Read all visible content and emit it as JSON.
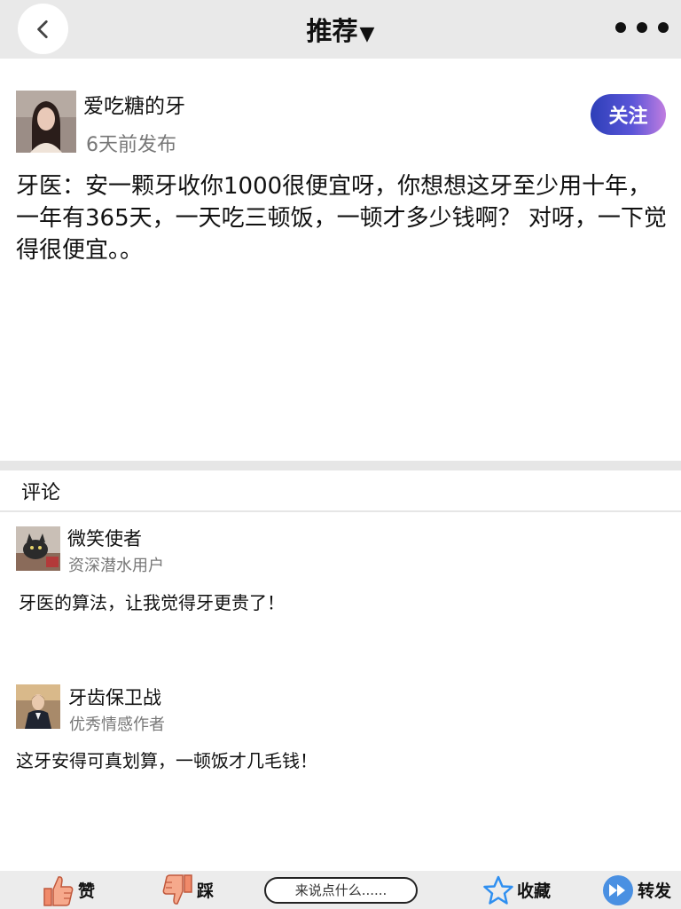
{
  "header": {
    "title": "推荐",
    "title_arrow": "▼"
  },
  "post": {
    "author": "爱吃糖的牙",
    "time": "6天前发布",
    "follow_label": "关注",
    "body": "牙医：安一颗牙收你1000很便宜呀，你想想这牙至少用十年，一年有365天，一天吃三顿饭，一顿才多少钱啊？ 对呀，一下觉得很便宜。。"
  },
  "comments": {
    "header": "评论",
    "items": [
      {
        "name": "微笑使者",
        "subtitle": "资深潜水用户",
        "text": "牙医的算法，让我觉得牙更贵了！"
      },
      {
        "name": "牙齿保卫战",
        "subtitle": "优秀情感作者",
        "text": "这牙安得可真划算，一顿饭才几毛钱！"
      }
    ]
  },
  "bottom_bar": {
    "like_label": "赞",
    "dislike_label": "踩",
    "input_placeholder": "来说点什么......",
    "favorite_label": "收藏",
    "share_label": "转发"
  },
  "colors": {
    "follow_gradient_start": "#2d3fb8",
    "follow_gradient_end": "#c07de0",
    "like_icon": "#f08a6a",
    "favorite_icon": "#2f8ff0",
    "share_icon": "#4a90e2"
  }
}
